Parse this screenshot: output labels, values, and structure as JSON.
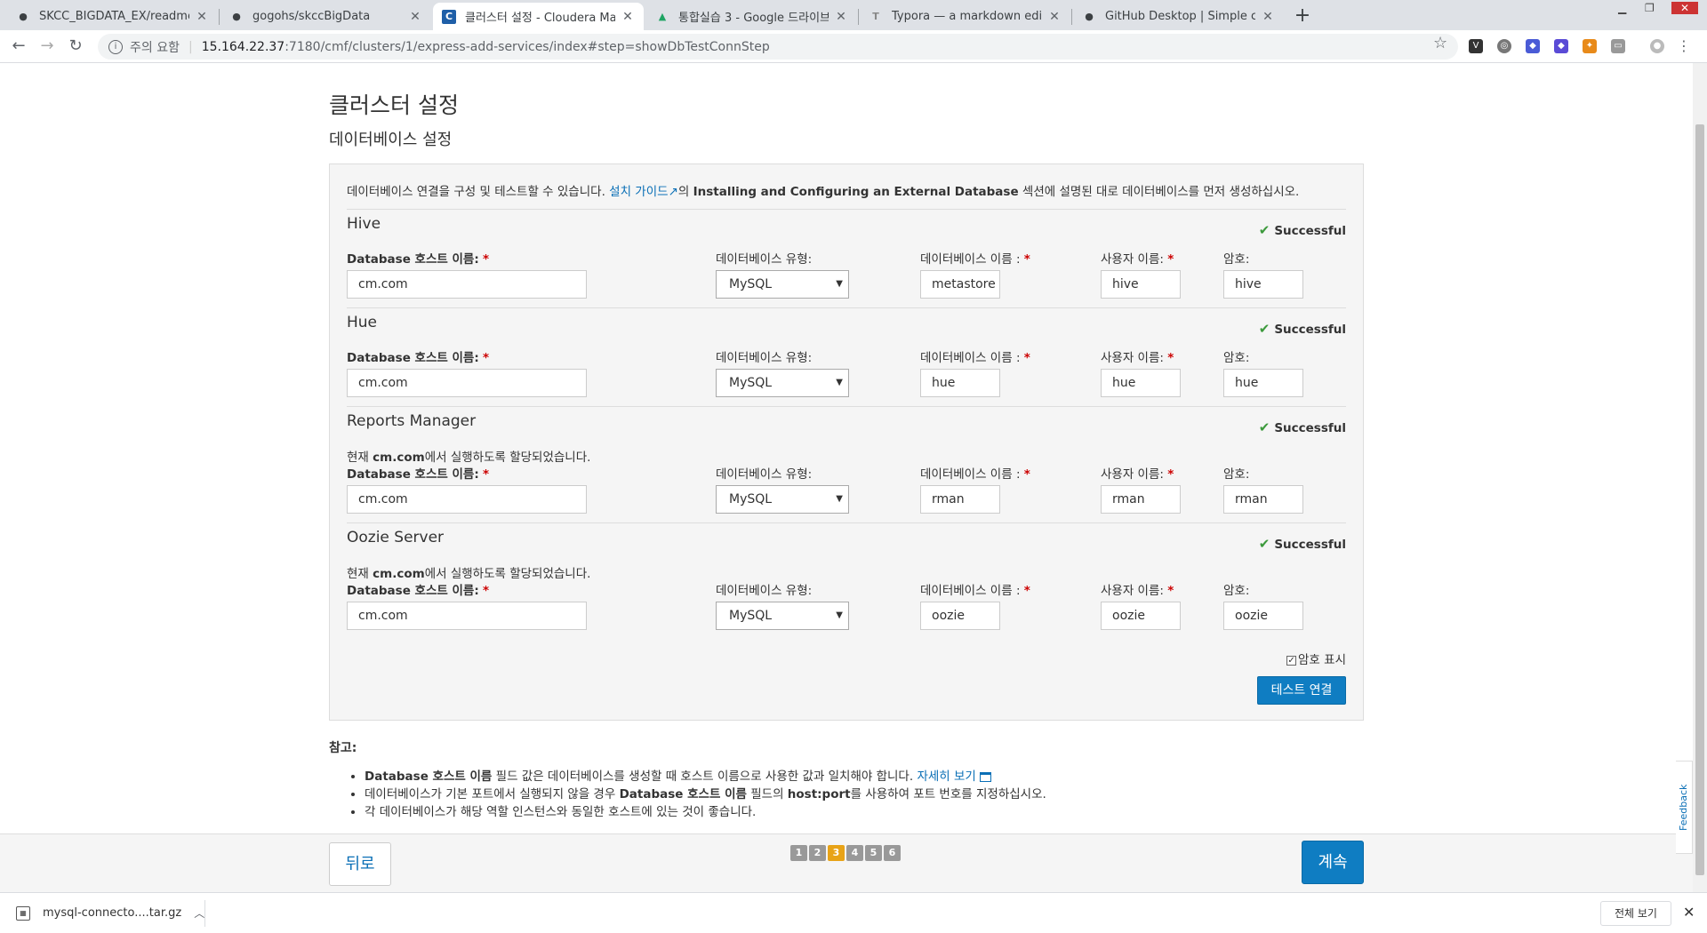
{
  "browser": {
    "tabs": [
      {
        "title": "SKCC_BIGDATA_EX/readme.md",
        "icon": "github-icon"
      },
      {
        "title": "gogohs/skccBigData",
        "icon": "github-icon"
      },
      {
        "title": "클러스터 설정 - Cloudera Mana",
        "icon": "cloudera-icon"
      },
      {
        "title": "통합실습 3 - Google 드라이브",
        "icon": "google-drive-icon"
      },
      {
        "title": "Typora — a markdown editor, m",
        "icon": "typora-icon"
      },
      {
        "title": "GitHub Desktop | Simple collab",
        "icon": "github-icon"
      }
    ],
    "security_label": "주의 요함",
    "url_host": "15.164.22.37",
    "url_path": ":7180/cmf/clusters/1/express-add-services/index#step=showDbTestConnStep"
  },
  "page": {
    "title": "클러스터 설정",
    "subtitle": "데이터베이스 설정",
    "intro_prefix": "데이터베이스 연결을 구성 및 테스트할 수 있습니다.",
    "intro_link": "설치 가이드",
    "intro_mid": "의",
    "intro_bold": "Installing and Configuring an External Database",
    "intro_suffix": "섹션에 설명된 대로 데이터베이스를 먼저 생성하십시오.",
    "labels": {
      "host": "Database 호스트 이름:",
      "type": "데이터베이스 유형:",
      "dbname": "데이터베이스 이름 :",
      "user": "사용자 이름:",
      "password": "암호:"
    },
    "status_text": "Successful",
    "note_prefix": "현재",
    "note_host": "cm.com",
    "note_suffix": "에서 실행하도록 할당되었습니다.",
    "services": [
      {
        "name": "Hive",
        "host": "cm.com",
        "type": "MySQL",
        "dbname": "metastore",
        "user": "hive",
        "password": "hive"
      },
      {
        "name": "Hue",
        "host": "cm.com",
        "type": "MySQL",
        "dbname": "hue",
        "user": "hue",
        "password": "hue"
      },
      {
        "name": "Reports Manager",
        "host": "cm.com",
        "type": "MySQL",
        "dbname": "rman",
        "user": "rman",
        "password": "rman"
      },
      {
        "name": "Oozie Server",
        "host": "cm.com",
        "type": "MySQL",
        "dbname": "oozie",
        "user": "oozie",
        "password": "oozie"
      }
    ],
    "show_password_label": "암호 표시",
    "test_button": "테스트 연결",
    "notes_head": "참고:",
    "notes": {
      "n1_bold": "Database 호스트 이름",
      "n1_text": " 필드 값은 데이터베이스를 생성할 때 호스트 이름으로 사용한 값과 일치해야 합니다. ",
      "n1_link": "자세히 보기",
      "n2_pre": "데이터베이스가 기본 포트에서 실행되지 않을 경우 ",
      "n2_bold1": "Database 호스트 이름",
      "n2_mid": " 필드의 ",
      "n2_bold2": "host:port",
      "n2_post": "를 사용하여 포트 번호를 지정하십시오.",
      "n3": "각 데이터베이스가 해당 역할 인스턴스와 동일한 호스트에 있는 것이 좋습니다."
    },
    "back_button": "뒤로",
    "continue_button": "계속",
    "steps": [
      "1",
      "2",
      "3",
      "4",
      "5",
      "6"
    ],
    "active_step": "3",
    "feedback": "Feedback"
  },
  "downloads": {
    "file": "mysql-connecto....tar.gz",
    "show_all": "전체 보기"
  },
  "colors": {
    "primary": "#0f7dc2",
    "link": "#0a6fb6",
    "success": "#3c9a3c",
    "active_step": "#e8a317"
  }
}
